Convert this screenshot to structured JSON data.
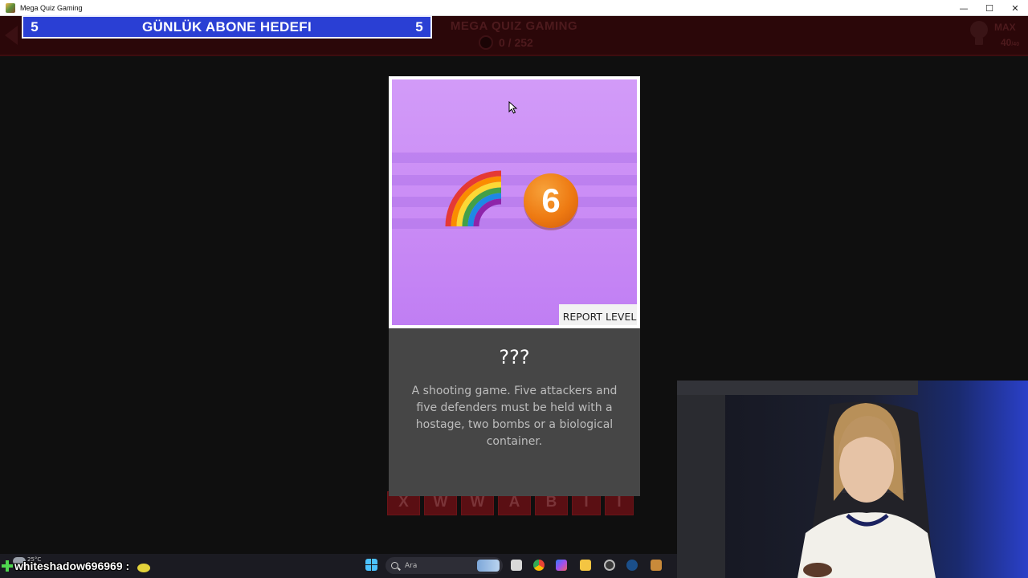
{
  "window": {
    "title": "Mega Quiz Gaming",
    "controls": {
      "minimize": "—",
      "maximize": "☐",
      "close": "✕"
    }
  },
  "overlay": {
    "goal_label": "GÜNLÜK ABONE HEDEFI",
    "goal_current": "5",
    "goal_target": "5"
  },
  "header": {
    "game_title": "MEGA QUIZ GAMING",
    "progress": "0 / 252",
    "hints_label": "MAX",
    "hints_count": "40",
    "hints_max": "/40"
  },
  "level": {
    "emoji_clues": [
      "rainbow",
      "6"
    ],
    "six_text": "6",
    "report_label": "REPORT LEVEL",
    "answer": "???",
    "description": "A shooting game. Five attackers and five defenders must be held with a hostage, two bombs or a biological container."
  },
  "letter_tiles": [
    "X",
    "W",
    "W",
    "A",
    "B",
    "I",
    "I"
  ],
  "stream": {
    "chat_user": "whiteshadow696969 :",
    "weather_temp": "25°C"
  },
  "taskbar": {
    "search_placeholder": "Ara"
  },
  "colors": {
    "goal_bg": "#2a3fd4",
    "puzzle_bg": "#c98af5",
    "info_bg": "#464646",
    "header_bg": "#2b0709"
  },
  "icons": [
    "app-icon",
    "back-arrow-icon",
    "coin-icon",
    "lightbulb-icon",
    "rainbow-icon",
    "six-icon",
    "cursor-icon",
    "plus-icon",
    "weather-icon",
    "windows-start-icon",
    "search-icon"
  ]
}
